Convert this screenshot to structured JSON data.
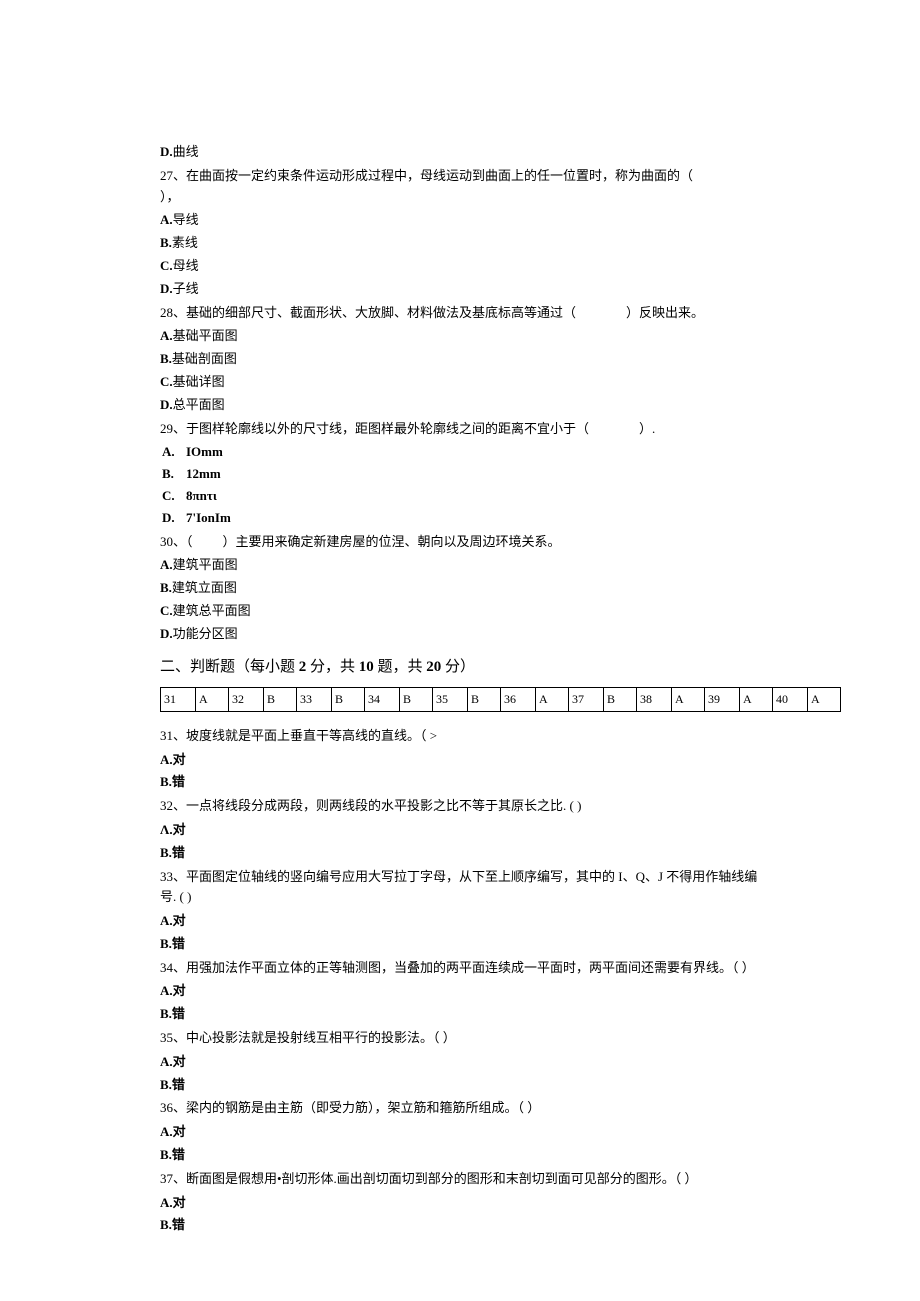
{
  "q26_optD": {
    "letter": "D.",
    "text": "曲线"
  },
  "q27": {
    "stem_pre": "27、在曲面按一定约束条件运动形成过程中，母线运动到曲面上的任一位置时，称为曲面的（",
    "stem_post": "），",
    "opts": [
      {
        "letter": "A.",
        "text": "导线"
      },
      {
        "letter": "B.",
        "text": "素线"
      },
      {
        "letter": "C.",
        "text": "母线"
      },
      {
        "letter": "D.",
        "text": "子线"
      }
    ]
  },
  "q28": {
    "stem_pre": "28、基础的细部尺寸、截面形状、大放脚、材料做法及基底标高等通过（",
    "stem_post": "）反映出来。",
    "opts": [
      {
        "letter": "A.",
        "text": "基础平面图"
      },
      {
        "letter": "B.",
        "text": "基础剖面图"
      },
      {
        "letter": "C.",
        "text": "基础详图"
      },
      {
        "letter": "D.",
        "text": "总平面图"
      }
    ]
  },
  "q29": {
    "stem_pre": "29、于图样轮廓线以外的尺寸线，距图样最外轮廓线之间的距离不宜小于（",
    "stem_post": "）.",
    "opts": [
      {
        "letter": "A.",
        "text": "IOmm"
      },
      {
        "letter": "B.",
        "text": "12mm"
      },
      {
        "letter": "C.",
        "text": "8πnτι"
      },
      {
        "letter": "D.",
        "text": "7'IonIm"
      }
    ]
  },
  "q30": {
    "stem_pre": "30、（",
    "stem_post": "）主要用来确定新建房屋的位涅、朝向以及周边环境关系。",
    "opts": [
      {
        "letter": "A.",
        "text": "建筑平面图"
      },
      {
        "letter": "B.",
        "text": "建筑立面图"
      },
      {
        "letter": "C.",
        "text": "建筑总平面图"
      },
      {
        "letter": "D.",
        "text": "功能分区图"
      }
    ]
  },
  "section2": {
    "title_pre": "二、判断题（每小题 ",
    "two": "2",
    "mid1": " 分，共 ",
    "ten": "10",
    "mid2": " 题，共 ",
    "twenty": "20",
    "title_post": " 分）"
  },
  "answers": [
    {
      "n": "31",
      "a": "A"
    },
    {
      "n": "32",
      "a": "B"
    },
    {
      "n": "33",
      "a": "B"
    },
    {
      "n": "34",
      "a": "B"
    },
    {
      "n": "35",
      "a": "B"
    },
    {
      "n": "36",
      "a": "A"
    },
    {
      "n": "37",
      "a": "B"
    },
    {
      "n": "38",
      "a": "A"
    },
    {
      "n": "39",
      "a": "A"
    },
    {
      "n": "40",
      "a": "A"
    }
  ],
  "tf": [
    {
      "stem": "31、坡度线就是平面上垂直干等高线的直线。（ >",
      "a": "A.对",
      "b": "B.错"
    },
    {
      "stem": "32、一点将线段分成两段，则两线段的水平投影之比不等于其原长之比. (  )",
      "a": "Λ.对",
      "b": "B.错"
    },
    {
      "stem": "33、平面图定位轴线的竖向编号应用大写拉丁字母，从下至上顺序编写，其中的 I、Q、J 不得用作轴线编号. (  )",
      "a": "A.对",
      "b": "B.错"
    },
    {
      "stem": "34、用强加法作平面立体的正等轴测图，当叠加的两平面连续成一平面时，两平面间还需要有界线。（ ）",
      "a": "A.对",
      "b": "B.错"
    },
    {
      "stem": "35、中心投影法就是投射线互相平行的投影法。（ ）",
      "a": "A.对",
      "b": "B.错"
    },
    {
      "stem": "36、梁内的钢筋是由主筋（即受力筋），架立筋和箍筋所组成。（ ）",
      "a": "A.对",
      "b": "B.错"
    },
    {
      "stem": "37、断面图是假想用•剖切形体.画出剖切面切到部分的图形和末剖切到面可见部分的图形。（ ）",
      "a": "A.对",
      "b": "B.错"
    }
  ]
}
